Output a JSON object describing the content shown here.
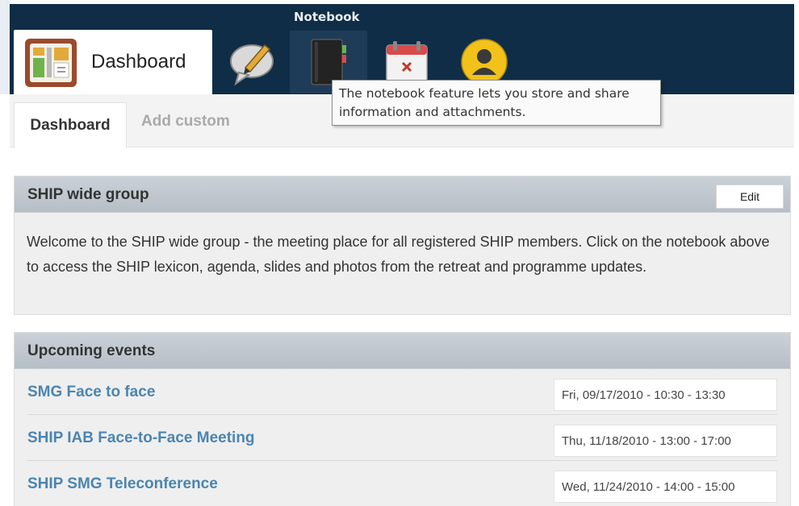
{
  "header": {
    "active_app_label": "Dashboard",
    "hover_icon_label": "Notebook",
    "apps": [
      {
        "icon": "dashboard-icon"
      },
      {
        "icon": "discussion-icon"
      },
      {
        "icon": "notebook-icon"
      },
      {
        "icon": "calendar-icon"
      },
      {
        "icon": "profile-icon"
      }
    ],
    "bg_color": "#0f2d47"
  },
  "tooltip": {
    "text": "The notebook feature lets you store and share information and attachments."
  },
  "subtabs": {
    "active": "Dashboard",
    "inactive": "Add custom"
  },
  "group_panel": {
    "title": "SHIP wide group",
    "edit_label": "Edit",
    "body": "Welcome to the SHIP wide group - the meeting place for all registered SHIP members. Click on the notebook above to access the SHIP lexicon, agenda, slides and photos from the retreat and programme updates."
  },
  "events_panel": {
    "title": "Upcoming events",
    "events": [
      {
        "title": "SMG Face to face",
        "date": "Fri, 09/17/2010 - 10:30 - 13:30"
      },
      {
        "title": "SHIP IAB Face-to-Face Meeting",
        "date": "Thu, 11/18/2010 - 13:00 - 17:00"
      },
      {
        "title": "SHIP SMG Teleconference",
        "date": "Wed, 11/24/2010 - 14:00 - 15:00"
      }
    ]
  },
  "colors": {
    "link": "#4b85b0",
    "panel_header": "#b6bec7"
  }
}
